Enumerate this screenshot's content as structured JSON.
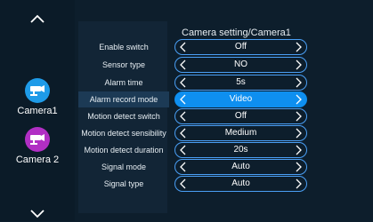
{
  "sidebar": {
    "cameras": [
      {
        "label": "Camera1",
        "icon": "security-camera-icon",
        "color": "#1e9be8"
      },
      {
        "label": "Camera 2",
        "icon": "security-camera-icon",
        "color": "#b12fc4"
      }
    ]
  },
  "settings": {
    "title": "Camera setting/Camera1",
    "rows": [
      {
        "label": "Enable switch",
        "value": "Off"
      },
      {
        "label": "Sensor type",
        "value": "NO"
      },
      {
        "label": "Alarm time",
        "value": "5s"
      },
      {
        "label": "Alarm record mode",
        "value": "Video",
        "selected": true
      },
      {
        "label": "Motion detect switch",
        "value": "Off"
      },
      {
        "label": "Motion detect sensibility",
        "value": "Medium"
      },
      {
        "label": "Motion detect duration",
        "value": "20s"
      },
      {
        "label": "Signal mode",
        "value": "Auto"
      },
      {
        "label": "Signal type",
        "value": "Auto"
      }
    ]
  },
  "colors": {
    "accent": "#0e8ff0",
    "background": "#0d1e2c"
  }
}
